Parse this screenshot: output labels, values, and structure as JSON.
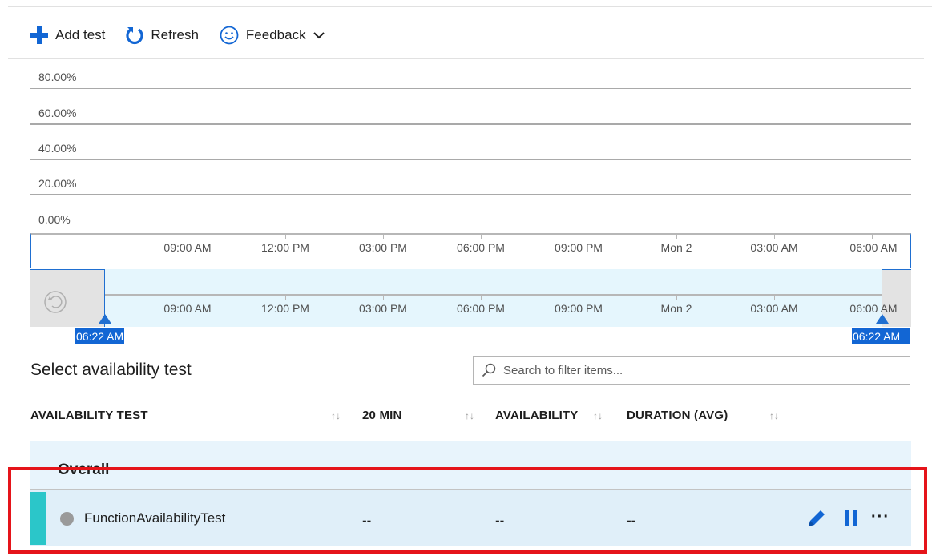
{
  "toolbar": {
    "add_test": "Add test",
    "refresh": "Refresh",
    "feedback": "Feedback",
    "icons": {
      "add": "plus-icon",
      "refresh": "refresh-icon",
      "feedback": "smiley-icon",
      "dropdown": "chevron-down-icon"
    },
    "accent_color": "#1266d4"
  },
  "chart": {
    "y_labels": [
      "80.00%",
      "60.00%",
      "40.00%",
      "20.00%",
      "0.00%"
    ]
  },
  "time_axis": {
    "ticks": [
      "09:00 AM",
      "12:00 PM",
      "03:00 PM",
      "06:00 PM",
      "09:00 PM",
      "Mon 2",
      "03:00 AM",
      "06:00 AM"
    ],
    "brush_ticks": [
      "09:00 AM",
      "12:00 PM",
      "03:00 PM",
      "06:00 PM",
      "09:00 PM",
      "Mon 2",
      "03:00 AM",
      "06:00 AM"
    ],
    "start_handle": "06:22 AM",
    "end_handle": "06:22 AM",
    "reset_icon": "reset-zoom-icon"
  },
  "section": {
    "title": "Select availability test",
    "search_placeholder": "Search to filter items..."
  },
  "table": {
    "headers": [
      "AVAILABILITY TEST",
      "20 MIN",
      "AVAILABILITY",
      "DURATION (AVG)"
    ],
    "sort_glyph": "↑↓",
    "overall": {
      "name": "Overall",
      "values": [
        "--",
        "--",
        "--"
      ]
    },
    "rows": [
      {
        "name": "FunctionAvailabilityTest",
        "values": [
          "--",
          "--",
          "--"
        ],
        "status_color": "#9a9a9a",
        "accent_color": "#2bc6c9"
      }
    ],
    "row_actions": {
      "edit": "edit-icon",
      "pause": "pause-icon",
      "more": "···"
    }
  }
}
